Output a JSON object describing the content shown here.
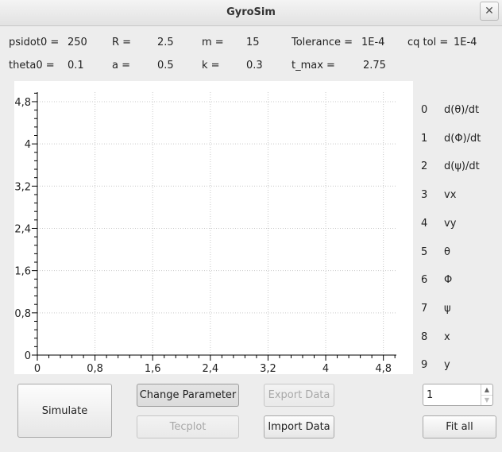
{
  "window": {
    "title": "GyroSim",
    "close_glyph": "✕"
  },
  "params": {
    "psidot0_label": "psidot0 =",
    "psidot0_value": "250",
    "R_label": "R =",
    "R_value": "2.5",
    "m_label": "m =",
    "m_value": "15",
    "tolerance_label": "Tolerance =",
    "tolerance_value": "1E-4",
    "cqtol_label": "cq tol =",
    "cqtol_value": "1E-4",
    "theta0_label": "theta0 =",
    "theta0_value": "0.1",
    "a_label": "a =",
    "a_value": "0.5",
    "k_label": "k =",
    "k_value": "0.3",
    "tmax_label": "t_max =",
    "tmax_value": "2.75"
  },
  "plot": {
    "x_ticks": [
      "0",
      "0,8",
      "1,6",
      "2,4",
      "3,2",
      "4",
      "4,8"
    ],
    "y_ticks": [
      "0",
      "0,8",
      "1,6",
      "2,4",
      "3,2",
      "4",
      "4,8"
    ],
    "grid": true
  },
  "legend": [
    {
      "index": "0",
      "label": "d(θ)/dt"
    },
    {
      "index": "1",
      "label": "d(Φ)/dt"
    },
    {
      "index": "2",
      "label": "d(ψ)/dt"
    },
    {
      "index": "3",
      "label": "vx"
    },
    {
      "index": "4",
      "label": "vy"
    },
    {
      "index": "5",
      "label": "θ"
    },
    {
      "index": "6",
      "label": "Φ"
    },
    {
      "index": "7",
      "label": "ψ"
    },
    {
      "index": "8",
      "label": "x"
    },
    {
      "index": "9",
      "label": "y"
    }
  ],
  "buttons": {
    "simulate": "Simulate",
    "change_parameter": "Change Parameter",
    "export_data": "Export Data",
    "tecplot": "Tecplot",
    "import_data": "Import Data",
    "fit_all": "Fit all"
  },
  "spinbox": {
    "value": "1",
    "up": "▲",
    "down": "▼"
  }
}
